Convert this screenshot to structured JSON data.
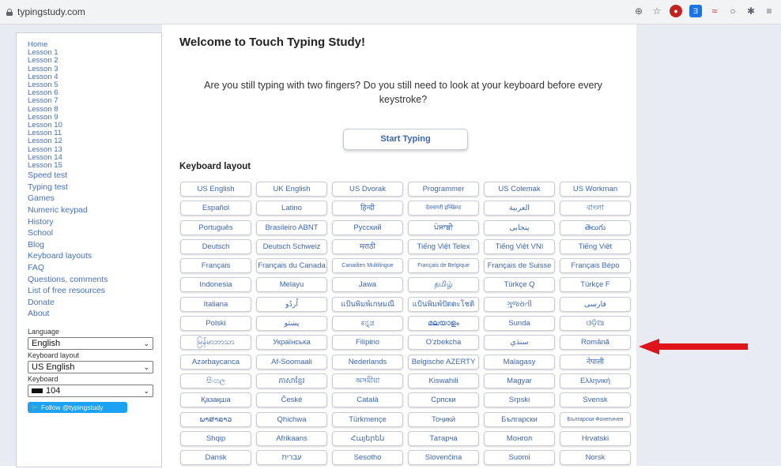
{
  "browser": {
    "url": "typingstudy.com",
    "toolbar_icons": [
      "zoom-icon",
      "star-icon",
      "extension-red-icon",
      "translate-icon",
      "extension-icon",
      "circle-icon",
      "puzzle-icon",
      "menu-icon"
    ]
  },
  "sidebar": {
    "nav_small": [
      "Home",
      "Lesson 1",
      "Lesson 2",
      "Lesson 3",
      "Lesson 4",
      "Lesson 5",
      "Lesson 6",
      "Lesson 7",
      "Lesson 8",
      "Lesson 9",
      "Lesson 10",
      "Lesson 11",
      "Lesson 12",
      "Lesson 13",
      "Lesson 14",
      "Lesson 15"
    ],
    "nav_big": [
      "Speed test",
      "Typing test",
      "Games",
      "Numeric keypad",
      "History",
      "School",
      "Blog",
      "Keyboard layouts",
      "FAQ",
      "Questions, comments",
      "List of free resources",
      "Donate",
      "About"
    ],
    "language_label": "Language",
    "language_value": "English",
    "layout_label": "Keyboard layout",
    "layout_value": "US English",
    "keyboard_label": "Keyboard",
    "keyboard_value": "104",
    "follow": "Follow @typingstudy"
  },
  "main": {
    "title": "Welcome to Touch Typing Study!",
    "intro": "Are you still typing with two fingers? Do you still need to look at your keyboard before every keystroke?",
    "start_button": "Start Typing",
    "layouts_title": "Keyboard layout",
    "layouts": [
      [
        "US English",
        "UK English",
        "US Dvorak",
        "Programmer",
        "US Colemak",
        "US Workman"
      ],
      [
        "Español",
        "Latino",
        "हिन्दी",
        "देवनागरी इन्स्क्रिप्ट",
        "العربية",
        "বাংলা"
      ],
      [
        "Português",
        "Brasileiro ABNT",
        "Русский",
        "ਪੰਜਾਬੀ",
        "پنجابی",
        "తెలుగు"
      ],
      [
        "Deutsch",
        "Deutsch Schweiz",
        "मराठी",
        "Tiếng Việt Telex",
        "Tiếng Việt VNI",
        "Tiếng Việt"
      ],
      [
        "Français",
        "Français du Canada",
        "Canadien Multilingue",
        "Français de Belgique",
        "Français de Suisse",
        "Français Bépo"
      ],
      [
        "Indonesia",
        "Melayu",
        "Jawa",
        "தமிழ்",
        "Türkçe Q",
        "Türkçe F"
      ],
      [
        "Italiana",
        "اُردُو",
        "แป้นพิมพ์เกษมณี",
        "แป้นพิมพ์ปัตตะโชติ",
        "ગુજરાતી",
        "فارسی"
      ],
      [
        "Polski",
        "پښتو",
        "ಕನ್ನಡ",
        "മലയാളം",
        "Sunda",
        "ଓଡ଼ିଆ"
      ],
      [
        "မြန်မာဘာသာ",
        "Українська",
        "Filipino",
        "O'zbekcha",
        "سنڌي",
        "Română"
      ],
      [
        "Azərbaycanca",
        "Af-Soomaali",
        "Nederlands",
        "Belgische AZERTY",
        "Malagasy",
        "नेपाली"
      ],
      [
        "සිංහල",
        "ភាសាខ្មែរ",
        "অসমীয়া",
        "Kiswahili",
        "Magyar",
        "Ελληνική"
      ],
      [
        "Қазақша",
        "České",
        "Català",
        "Српски",
        "Srpski",
        "Svensk"
      ],
      [
        "ພາສາລາວ",
        "Qhichwa",
        "Türkmençe",
        "Тоҷикӣ",
        "Български",
        "Български Фонетичен"
      ],
      [
        "Shqip",
        "Afrikaans",
        "Հայերեն",
        "Татарча",
        "Монгол",
        "Hrvatski"
      ],
      [
        "Dansk",
        "עברית",
        "Sesotho",
        "Slovenčina",
        "Suomi",
        "Norsk"
      ]
    ]
  },
  "colors": {
    "link": "#4470c4",
    "page_bg": "#e9ebf3",
    "arrow": "#e0121a"
  }
}
